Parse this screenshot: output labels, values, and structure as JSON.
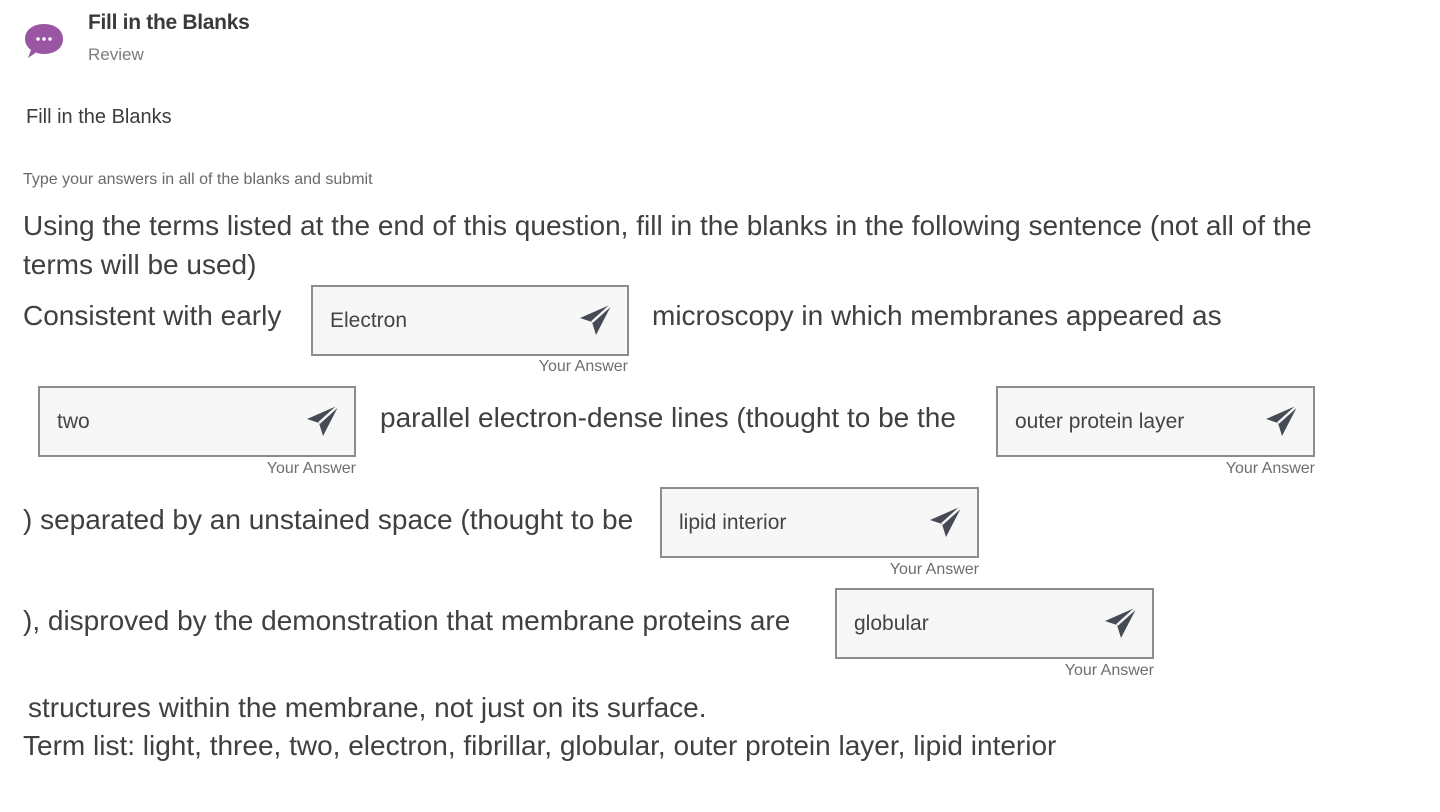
{
  "header": {
    "title": "Fill in the Blanks",
    "subtitle": "Review",
    "avatar_color": "#9a55a3"
  },
  "section_title": "Fill in the Blanks",
  "instruction": "Type your answers in all of the blanks and submit",
  "question": {
    "prompt_line1": "Using the terms listed at the end of this question, fill in the blanks in the following sentence (not all of the",
    "prompt_line2": "terms will be used)",
    "segments": [
      "Consistent with early",
      "microscopy in which membranes appeared as",
      "parallel electron-dense lines (thought to be the",
      ") separated by an unstained space (thought to be",
      "), disproved by the demonstration that membrane proteins are",
      "structures within the membrane, not just on its surface."
    ],
    "term_list": "Term list: light, three, two, electron, fibrillar, globular, outer protein layer, lipid interior"
  },
  "blanks": [
    {
      "value": "Electron",
      "caption": "Your Answer",
      "icon": "send-icon"
    },
    {
      "value": "two",
      "caption": "Your Answer",
      "icon": "send-icon"
    },
    {
      "value": "outer protein layer",
      "caption": "Your Answer",
      "icon": "send-icon"
    },
    {
      "value": "lipid interior",
      "caption": "Your Answer",
      "icon": "send-icon"
    },
    {
      "value": "globular",
      "caption": "Your Answer",
      "icon": "send-icon"
    }
  ]
}
